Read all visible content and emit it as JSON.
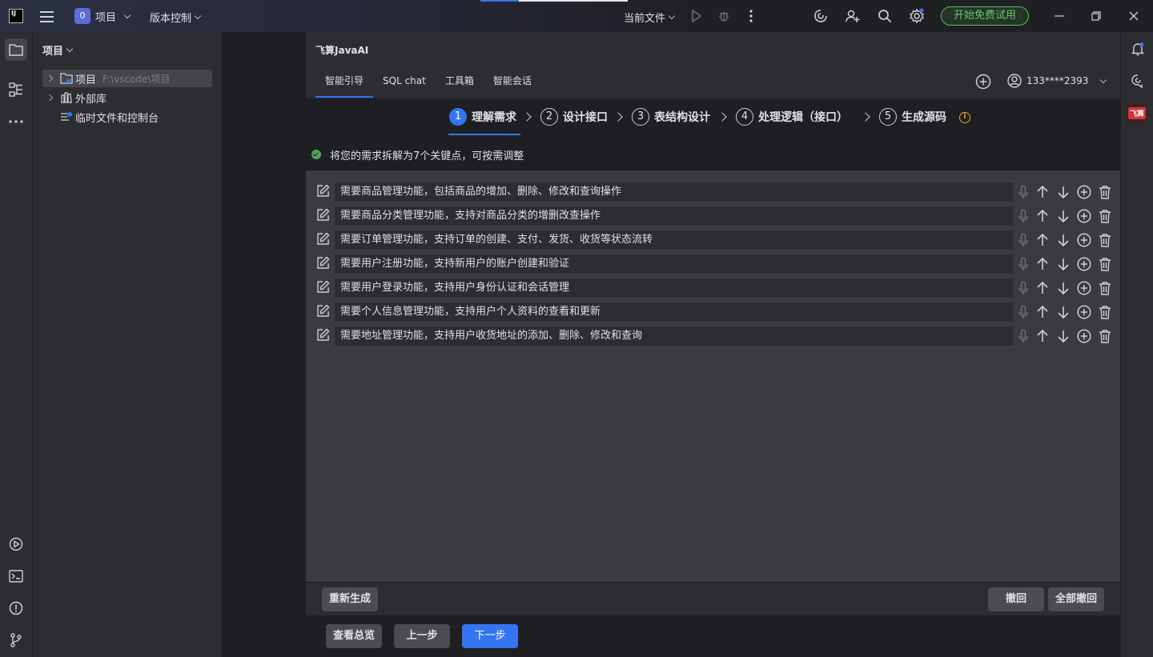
{
  "titlebar": {
    "logo_text": "IJ",
    "project_badge": "0",
    "project_menu": "项目",
    "vcs_menu": "版本控制",
    "current_file": "当前文件",
    "trial_button": "开始免费试用"
  },
  "project_panel": {
    "header": "项目",
    "tree": [
      {
        "label": "项目",
        "path": "F:\\vscode\\项目"
      },
      {
        "label": "外部库"
      },
      {
        "label": "临时文件和控制台"
      }
    ]
  },
  "plugin": {
    "title": "飞算JavaAI",
    "tabs": [
      "智能引导",
      "SQL chat",
      "工具箱",
      "智能会话"
    ],
    "user": "133****2393",
    "steps": [
      {
        "num": "1",
        "label": "理解需求"
      },
      {
        "num": "2",
        "label": "设计接口"
      },
      {
        "num": "3",
        "label": "表结构设计"
      },
      {
        "num": "4",
        "label": "处理逻辑（接口）"
      },
      {
        "num": "5",
        "label": "生成源码"
      }
    ],
    "hint": "将您的需求拆解为7个关键点，可按需调整",
    "requirements": [
      "需要商品管理功能，包括商品的增加、删除、修改和查询操作",
      "需要商品分类管理功能，支持对商品分类的增删改查操作",
      "需要订单管理功能，支持订单的创建、支付、发货、收货等状态流转",
      "需要用户注册功能，支持新用户的账户创建和验证",
      "需要用户登录功能，支持用户身份认证和会话管理",
      "需要个人信息管理功能，支持用户个人资料的查看和更新",
      "需要地址管理功能，支持用户收货地址的添加、删除、修改和查询"
    ],
    "regenerate": "重新生成",
    "undo": "撤回",
    "undo_all": "全部撤回",
    "overview": "查看总览",
    "prev": "上一步",
    "next": "下一步"
  },
  "right_strip": {
    "brand_badge": "飞算"
  }
}
